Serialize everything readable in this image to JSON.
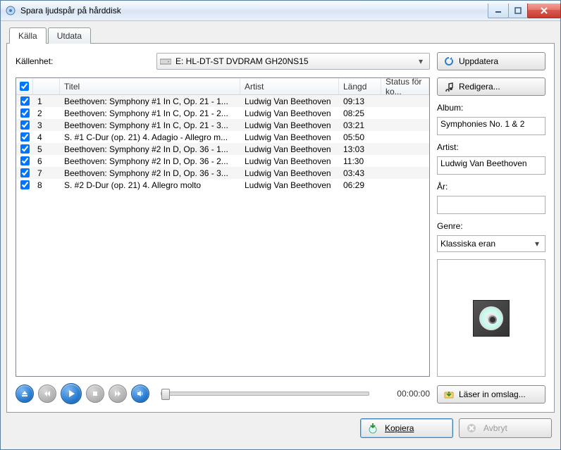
{
  "window": {
    "title": "Spara ljudspår på hårddisk"
  },
  "tabs": {
    "source": "Källa",
    "output": "Utdata"
  },
  "source_unit_label": "Källenhet:",
  "drive": "E: HL-DT-ST DVDRAM GH20NS15",
  "buttons": {
    "update": "Uppdatera",
    "edit": "Redigera...",
    "load_cover": "Läser in omslag...",
    "copy": "Kopiera",
    "cancel": "Avbryt"
  },
  "columns": {
    "title": "Titel",
    "artist": "Artist",
    "length": "Längd",
    "status": "Status för ko..."
  },
  "tracks": [
    {
      "n": "1",
      "title": "Beethoven: Symphony #1 In C, Op. 21 - 1...",
      "artist": "Ludwig Van Beethoven",
      "len": "09:13"
    },
    {
      "n": "2",
      "title": "Beethoven: Symphony #1 In C, Op. 21 - 2...",
      "artist": "Ludwig Van Beethoven",
      "len": "08:25"
    },
    {
      "n": "3",
      "title": "Beethoven: Symphony #1 In C, Op. 21 - 3...",
      "artist": "Ludwig Van Beethoven",
      "len": "03:21"
    },
    {
      "n": "4",
      "title": "S. #1 C-Dur (op. 21) 4. Adagio - Allegro m...",
      "artist": "Ludwig Van Beethoven",
      "len": "05:50"
    },
    {
      "n": "5",
      "title": "Beethoven: Symphony #2 In D, Op. 36 - 1...",
      "artist": "Ludwig Van Beethoven",
      "len": "13:03"
    },
    {
      "n": "6",
      "title": "Beethoven: Symphony #2 In D, Op. 36 - 2...",
      "artist": "Ludwig Van Beethoven",
      "len": "11:30"
    },
    {
      "n": "7",
      "title": "Beethoven: Symphony #2 In D, Op. 36 - 3...",
      "artist": "Ludwig Van Beethoven",
      "len": "03:43"
    },
    {
      "n": "8",
      "title": "S. #2 D-Dur (op. 21) 4. Allegro molto",
      "artist": "Ludwig Van Beethoven",
      "len": "06:29"
    }
  ],
  "meta": {
    "album_label": "Album:",
    "album": "Symphonies No. 1 & 2",
    "artist_label": "Artist:",
    "artist": "Ludwig Van Beethoven",
    "year_label": "År:",
    "year": "",
    "genre_label": "Genre:",
    "genre": "Klassiska eran"
  },
  "player": {
    "time": "00:00:00"
  }
}
